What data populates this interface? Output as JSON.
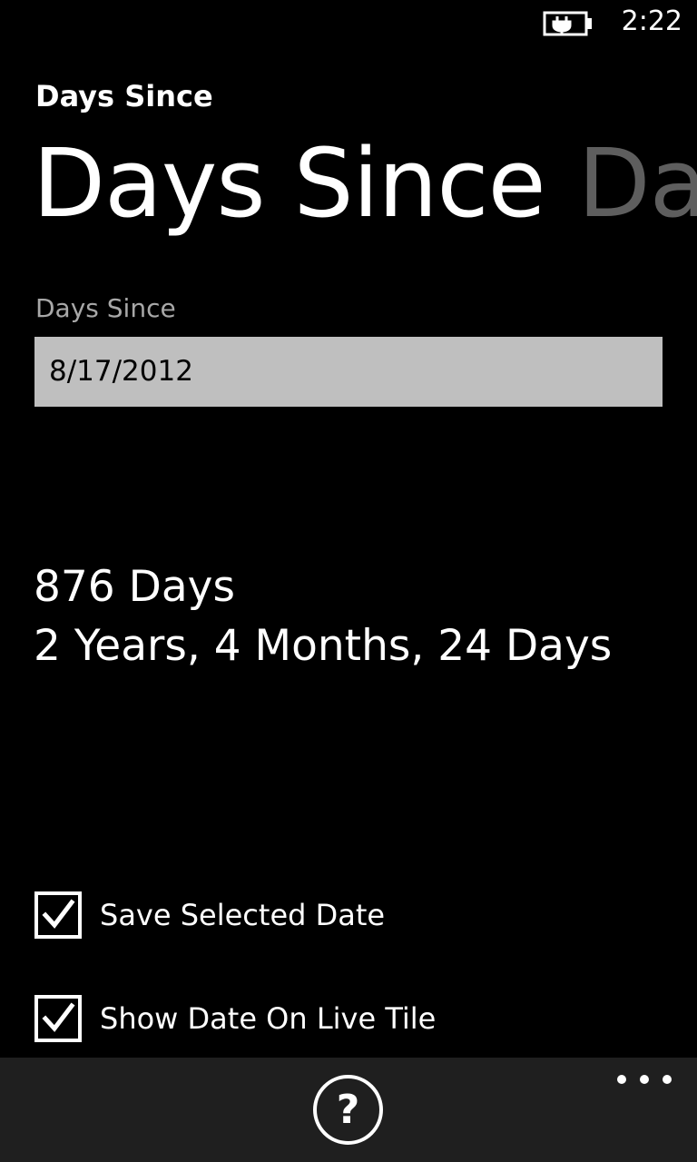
{
  "status_bar": {
    "time": "2:22",
    "battery_icon": "battery-charging-icon"
  },
  "app": {
    "title": "Days Since"
  },
  "pivot": {
    "tabs": [
      {
        "label": "Days Since",
        "active": true
      },
      {
        "label": "Dat",
        "active": false
      }
    ]
  },
  "date_field": {
    "label": "Days Since",
    "value": "8/17/2012"
  },
  "results": {
    "total_days": "876 Days",
    "breakdown": "2 Years, 4 Months, 24 Days"
  },
  "options": [
    {
      "label": "Save Selected Date",
      "checked": true
    },
    {
      "label": "Show Date On Live Tile",
      "checked": true
    }
  ],
  "app_bar": {
    "help_icon": "question-mark-icon",
    "help_glyph": "?",
    "more_icon": "ellipsis-icon"
  },
  "colors": {
    "background": "#000000",
    "app_bar": "#1f1f1f",
    "input_background": "#bfbfbf",
    "inactive_tab": "#5e5e5e",
    "label_gray": "#a8a8a8"
  }
}
